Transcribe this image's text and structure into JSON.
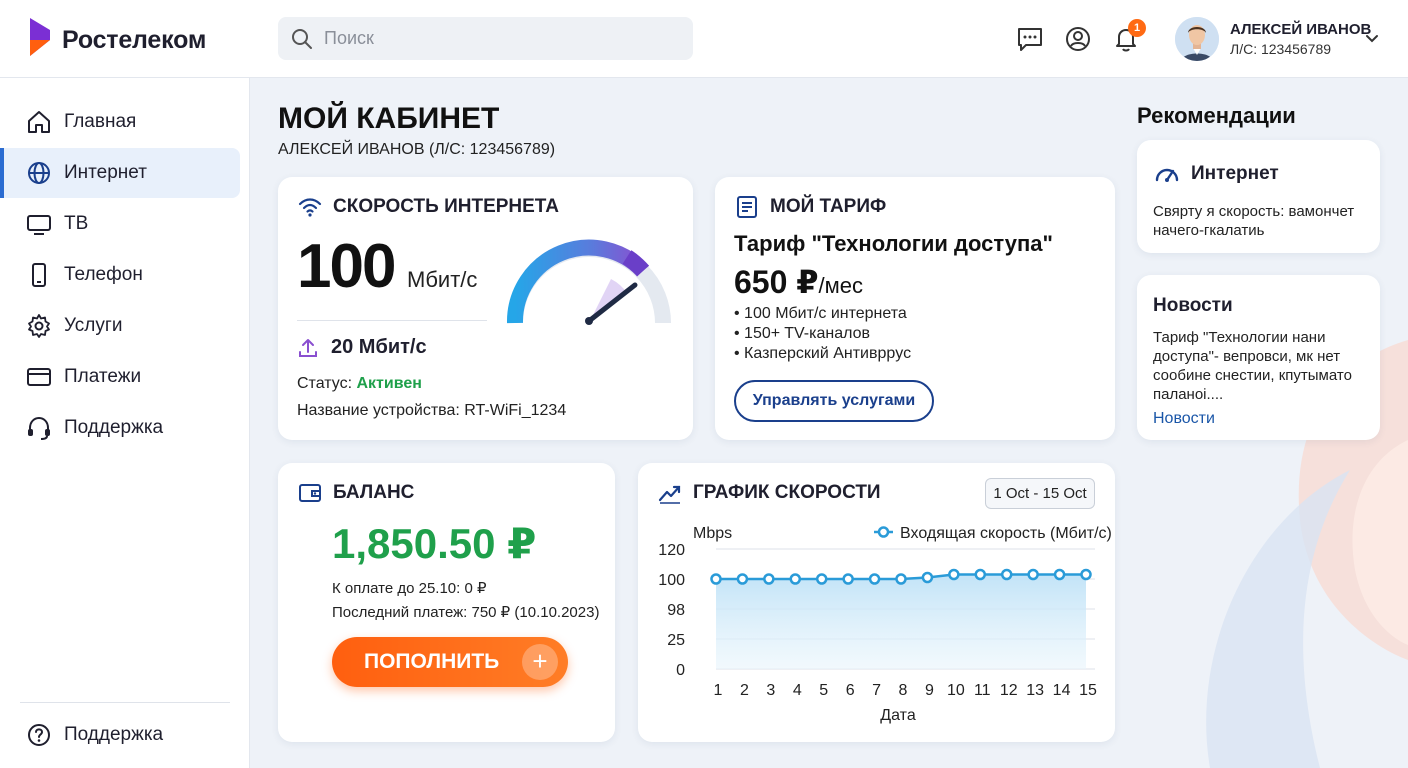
{
  "brand": {
    "name": "Ростелеком",
    "accent": "#7b2fd4",
    "orange": "#ff5f0f"
  },
  "search": {
    "placeholder": "Поиск"
  },
  "header": {
    "notification_count": "1"
  },
  "user": {
    "name": "АЛЕКСЕЙ ИВАНОВ",
    "account": "Л/С: 123456789"
  },
  "sidebar": {
    "items": [
      {
        "label": "Главная",
        "icon": "home-icon"
      },
      {
        "label": "Интернет",
        "icon": "globe-icon",
        "active": true
      },
      {
        "label": "ТВ",
        "icon": "tv-icon"
      },
      {
        "label": "Телефон",
        "icon": "phone-icon"
      },
      {
        "label": "Услуги",
        "icon": "gear-icon"
      },
      {
        "label": "Платежи",
        "icon": "card-icon"
      },
      {
        "label": "Поддержка",
        "icon": "headset-icon"
      }
    ],
    "footer": {
      "label": "Поддержка",
      "icon": "help-icon"
    }
  },
  "page": {
    "title": "МОЙ КАБИНЕТ",
    "subtitle": "АЛЕКСЕЙ ИВАНОВ (Л/С: 123456789)"
  },
  "speed_card": {
    "title": "СКОРОСТЬ ИНТЕРНЕТА",
    "download": "100",
    "unit": "Мбит/с",
    "upload": "20 Мбит/с",
    "status_label": "Статус:",
    "status_value": "Активен",
    "device": "Название устройства: RT-WiFi_1234"
  },
  "tariff_card": {
    "title": "МОЙ ТАРИФ",
    "name": "Тариф \"Технологии доступа\"",
    "price": "650 ₽",
    "per": "/мес",
    "features": [
      "100 Мбит/с интернета",
      "150+ TV-каналов",
      "Казперский Антиврpус"
    ],
    "button": "Управлять услугами"
  },
  "balance_card": {
    "title": "БАЛАНС",
    "value": "1,850.50 ₽",
    "due": "К оплате до 25.10: 0 ₽",
    "last_payment": "Последний платеж: 750 ₽ (10.10.2023)",
    "button": "ПОПОЛНИТЬ",
    "button_icon": "plus-icon"
  },
  "chart_card": {
    "title": "ГРАФИК СКОРОСТИ",
    "date_range": "1 Oct - 15 Oct"
  },
  "chart_data": {
    "type": "area",
    "title": "",
    "xlabel": "Дата",
    "ylabel": "Mbps",
    "legend": "Входящая скорость (Мбит/с)",
    "legend_position": "top-right",
    "x": [
      1,
      2,
      3,
      4,
      5,
      6,
      7,
      8,
      9,
      10,
      11,
      12,
      13,
      14,
      15
    ],
    "y_tick_labels": [
      "120",
      "100",
      "98",
      "25",
      "0"
    ],
    "series": [
      {
        "name": "Входящая скорость (Мбит/с)",
        "values": [
          100,
          100,
          100,
          100,
          100,
          100,
          100,
          100,
          101,
          103,
          103,
          103,
          103,
          103,
          103
        ]
      }
    ],
    "grid": true,
    "color": "#2a9bd8"
  },
  "recommendations": {
    "title": "Рекомендации",
    "internet": {
      "title": "Интернет",
      "text": "Свярту я скорость: вамончет начего-гкалатиь"
    },
    "news": {
      "title": "Новости",
      "text": "Тариф \"Технологии нани доступа\"- вепровси, мк нет сообине снестии, кпутымато паланоі....",
      "link": "Новости"
    }
  }
}
